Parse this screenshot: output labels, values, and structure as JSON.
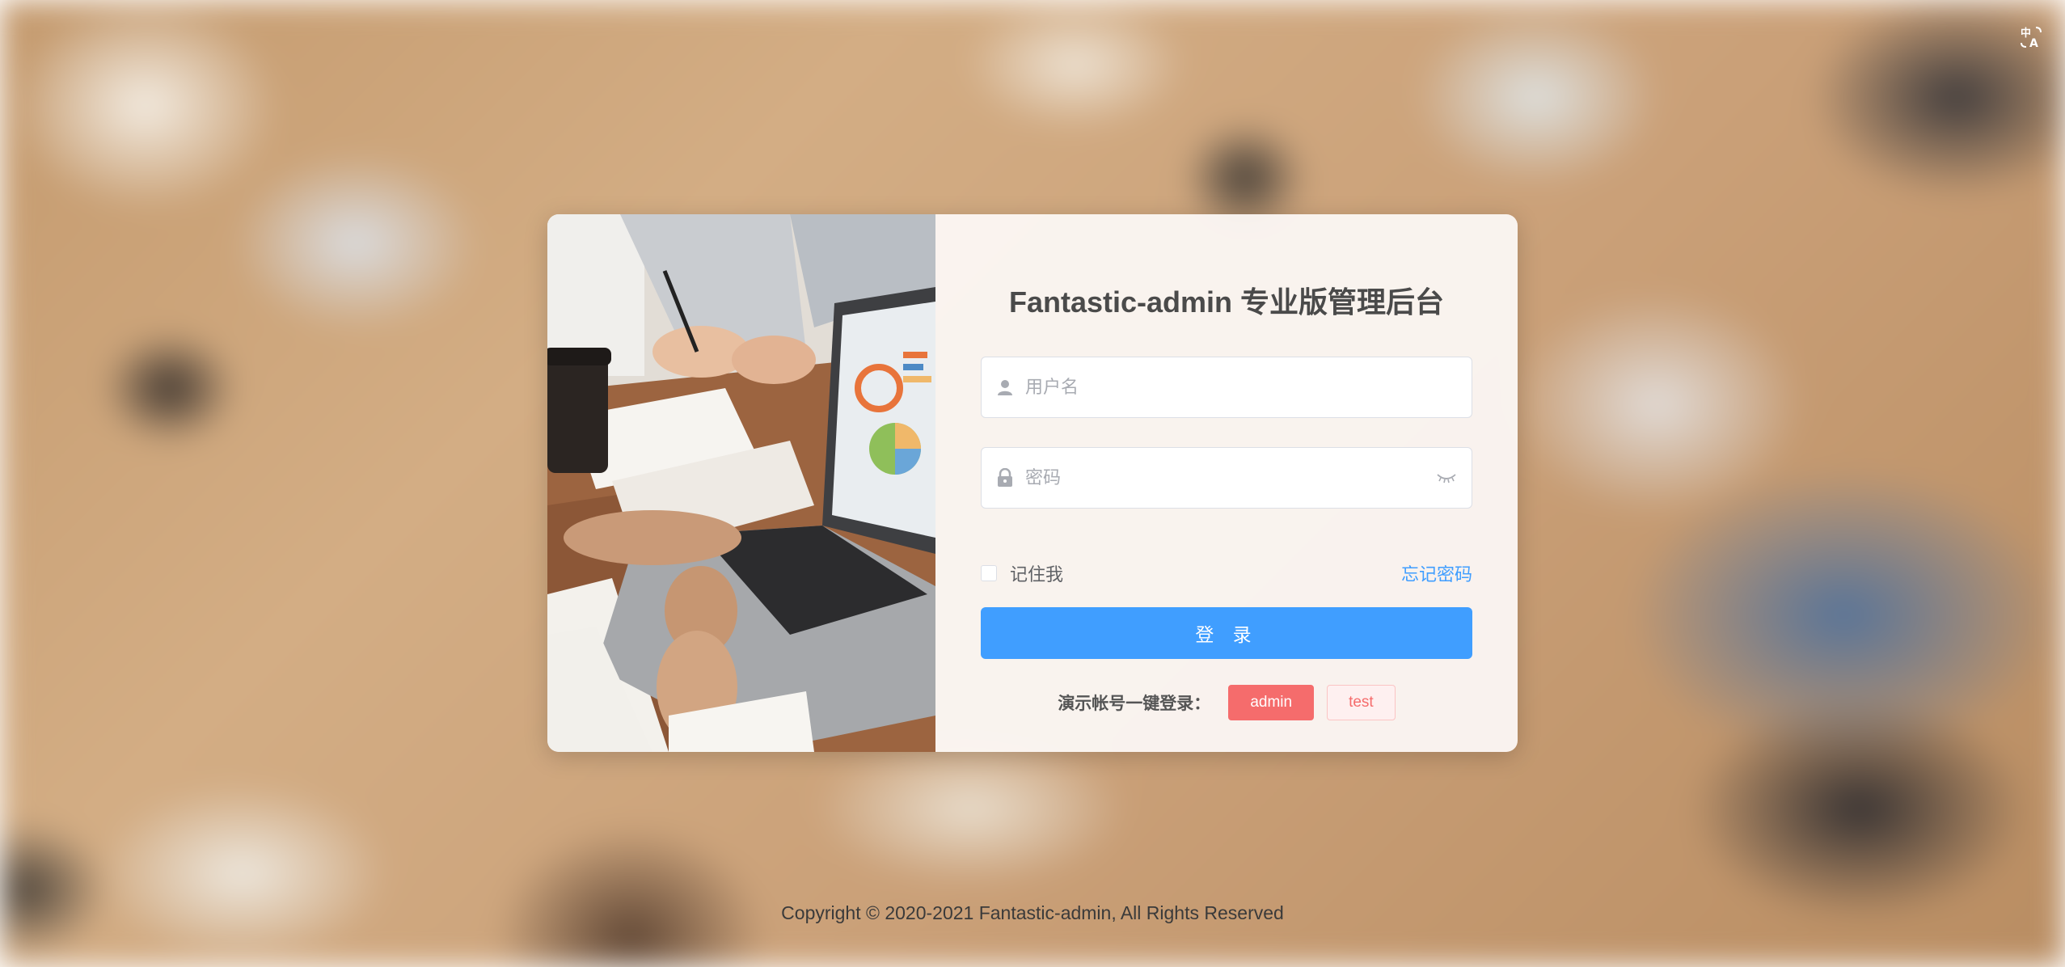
{
  "header": {
    "language_icon": "translate-icon"
  },
  "login": {
    "title": "Fantastic-admin 专业版管理后台",
    "username": {
      "placeholder": "用户名",
      "value": "",
      "icon": "user-icon"
    },
    "password": {
      "placeholder": "密码",
      "value": "",
      "icon": "lock-icon",
      "toggle_icon": "eye-closed-icon"
    },
    "remember_label": "记住我",
    "remember_checked": false,
    "forgot_label": "忘记密码",
    "submit_label": "登 录",
    "demo": {
      "label": "演示帐号一键登录：",
      "accounts": [
        "admin",
        "test"
      ]
    }
  },
  "footer": {
    "copyright": "Copyright © 2020-2021 Fantastic-admin, All Rights Reserved"
  },
  "colors": {
    "primary": "#409eff",
    "danger": "#f56c6c",
    "title": "#4a4a4a"
  }
}
